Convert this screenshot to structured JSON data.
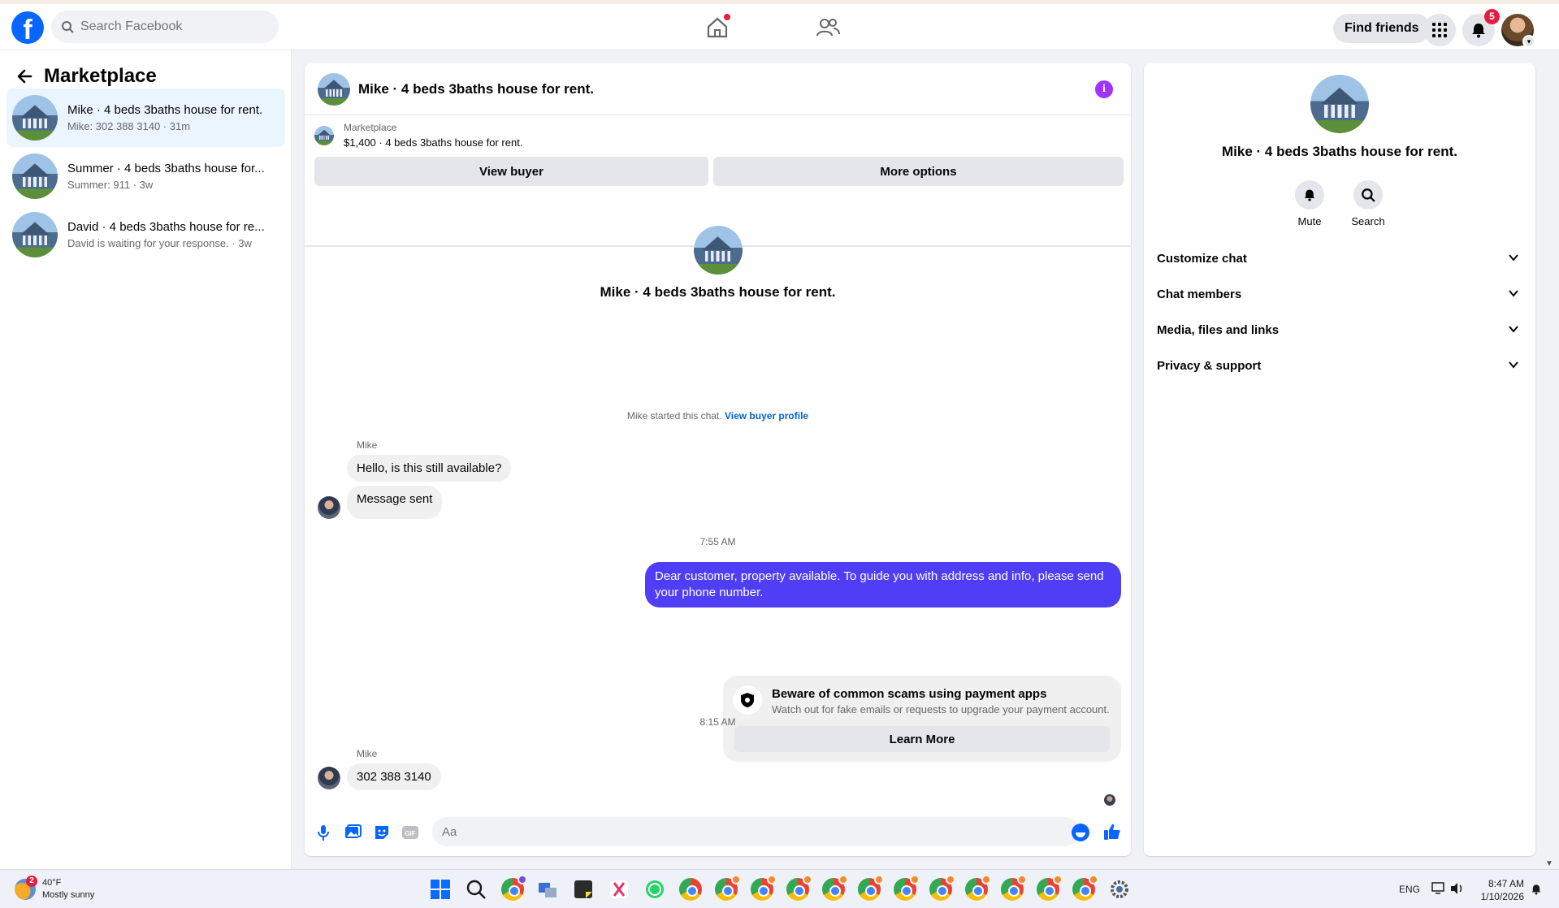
{
  "topbar": {
    "search_placeholder": "Search Facebook",
    "find_friends_label": "Find friends",
    "notifications_count": "5"
  },
  "sidebar": {
    "title": "Marketplace",
    "conversations": [
      {
        "title": "Mike · 4 beds 3baths house for rent.",
        "subtitle": "Mike: 302 388 3140 · 31m"
      },
      {
        "title": "Summer · 4 beds 3baths house for...",
        "subtitle": "Summer: 911 · 3w"
      },
      {
        "title": "David · 4 beds 3baths house for re...",
        "subtitle": "David is waiting for your response. · 3w"
      }
    ]
  },
  "chat": {
    "header_title": "Mike · 4 beds 3baths house for rent.",
    "marketplace_label": "Marketplace",
    "listing_detail": "$1,400 · 4 beds 3baths house for rent.",
    "view_buyer_label": "View buyer",
    "more_options_label": "More options",
    "intro_name": "Mike · 4 beds 3baths house for rent.",
    "started_text": "Mike started this chat.",
    "view_buyer_profile_label": "View buyer profile",
    "messages": [
      {
        "sender": "Mike",
        "text": "Hello, is this still available?"
      },
      {
        "text": "Message sent"
      },
      {
        "timestamp": "7:55 AM"
      },
      {
        "text": "Dear customer, property available. To guide you with address and info, please send your phone number."
      },
      {
        "timestamp": "8:15 AM"
      },
      {
        "sender": "Mike",
        "text": "302 388 3140"
      }
    ],
    "scam_notice": {
      "title": "Beware of common scams using payment apps",
      "description": "Watch out for fake emails or requests to upgrade your payment account.",
      "button_label": "Learn More"
    },
    "composer_placeholder": "Aa"
  },
  "details_panel": {
    "name": "Mike · 4 beds 3baths house for rent.",
    "actions": [
      {
        "label": "Mute",
        "icon": "bell-icon"
      },
      {
        "label": "Search",
        "icon": "search-icon"
      }
    ],
    "sections": [
      "Customize chat",
      "Chat members",
      "Media, files and links",
      "Privacy & support"
    ]
  },
  "taskbar": {
    "weather_temp": "40°F",
    "weather_desc": "Mostly sunny",
    "weather_badge": "2",
    "language": "ENG",
    "time": "8:47 AM",
    "date": "1/10/2026"
  },
  "colors": {
    "brand": "#0866ff",
    "outgoing_bubble": "#4f3ef5",
    "info_icon": "#a033ff",
    "badge": "#e41e3f"
  }
}
